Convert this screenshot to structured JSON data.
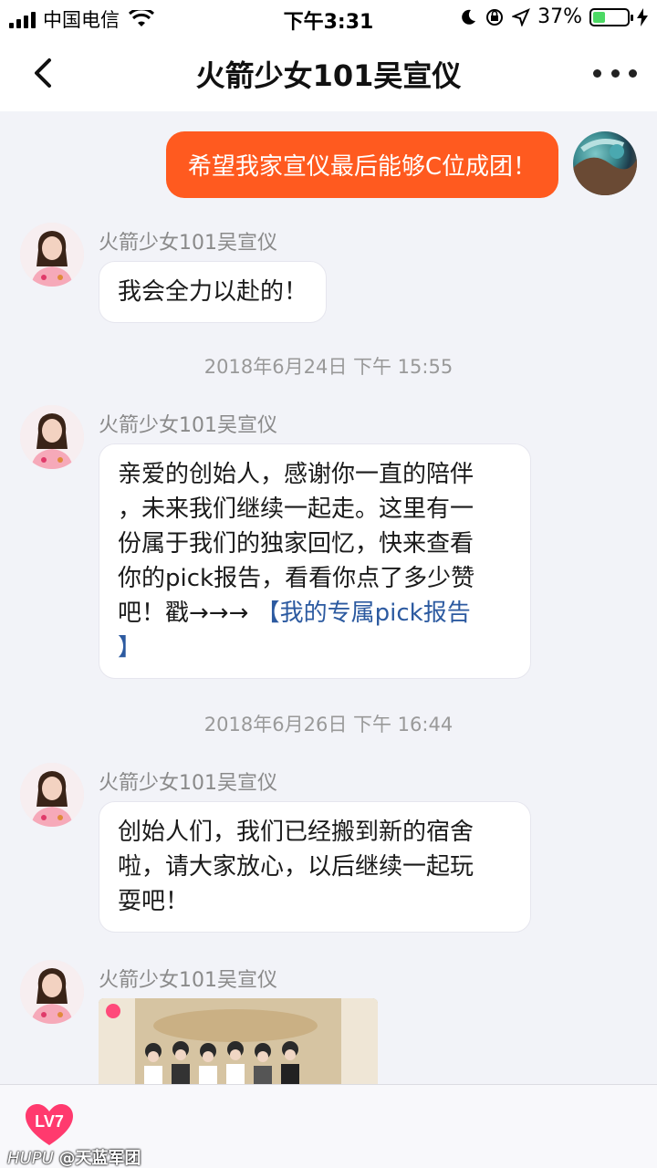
{
  "status_bar": {
    "carrier": "中国电信",
    "time": "下午3:31",
    "battery": "37%",
    "battery_level": 0.37
  },
  "nav": {
    "title": "火箭少女101吴宣仪"
  },
  "messages": {
    "outgoing_1": "希望我家宣仪最后能够C位成团！",
    "sender": "火箭少女101吴宣仪",
    "reply_1": "我会全力以赴的！",
    "timestamp_1": "2018年6月24日 下午 15:55",
    "msg_2_line1": "亲爱的创始人，感谢你一直的陪伴",
    "msg_2_line2": "，未来我们继续一起走。这里有一",
    "msg_2_line3": "份属于我们的独家回忆，快来查看",
    "msg_2_line4": "你的pick报告，看看你点了多少赞",
    "msg_2_line5": "吧！戳→→→ ",
    "msg_2_link": "【我的专属pick报告",
    "msg_2_link_end": "】",
    "timestamp_2": "2018年6月26日 下午 16:44",
    "msg_3_line1": "创始人们，我们已经搬到新的宿舍",
    "msg_3_line2": "啦，请大家放心，以后继续一起玩",
    "msg_3_line3": "耍吧！"
  },
  "bottom": {
    "level_badge": "LV7",
    "watermark_brand": "HUPU",
    "watermark_user": "@天蓝军团"
  },
  "colors": {
    "outgoing_bubble": "#ff5a1f",
    "link": "#2c5aa0",
    "badge": "#ff3a6e"
  }
}
